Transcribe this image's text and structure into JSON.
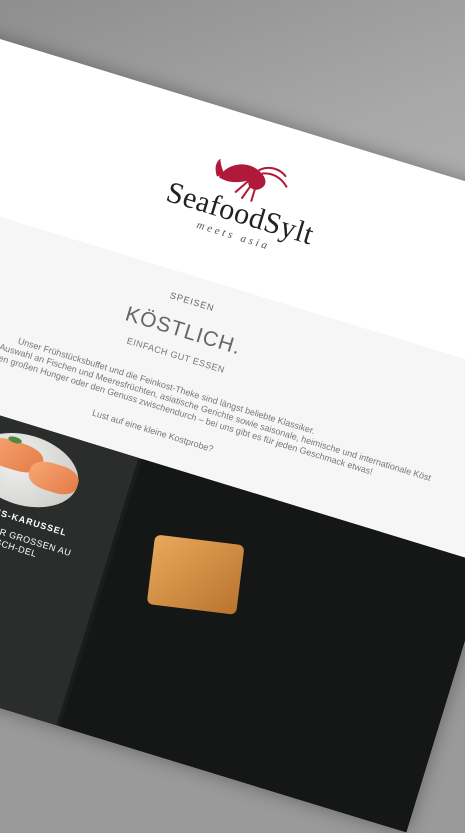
{
  "brand": {
    "name": "SeafoodSylt",
    "subtitle": "meets asia",
    "logo_icon": "lobster-icon",
    "logo_color": "#b0193a"
  },
  "intro": {
    "eyebrow": "SPEISEN",
    "headline": "KÖSTLICH.",
    "tagline": "EINFACH GUT ESSEN",
    "paragraph": [
      "Unser Frühstücksbuffet und die Feinkost-Theke sind längst beliebte Klassiker.",
      "Dazu zudem unsere große Auswahl an Fischen und Meeresfrüchten, asiatische Gerichte sowie saisonale, heimische und internationale Köst",
      "Egal, ob für den großen Hunger oder den Genuss zwischendurch – bei uns gibt es für jeden Geschmack etwas!"
    ],
    "cta": "Lust auf eine kleine Kostprobe?"
  },
  "tiles": {
    "middle_title": "LACHS-KARUSSEL",
    "middle_text": [
      "MIT EINER GROSSEN AU",
      "FISCH-DEL"
    ]
  }
}
